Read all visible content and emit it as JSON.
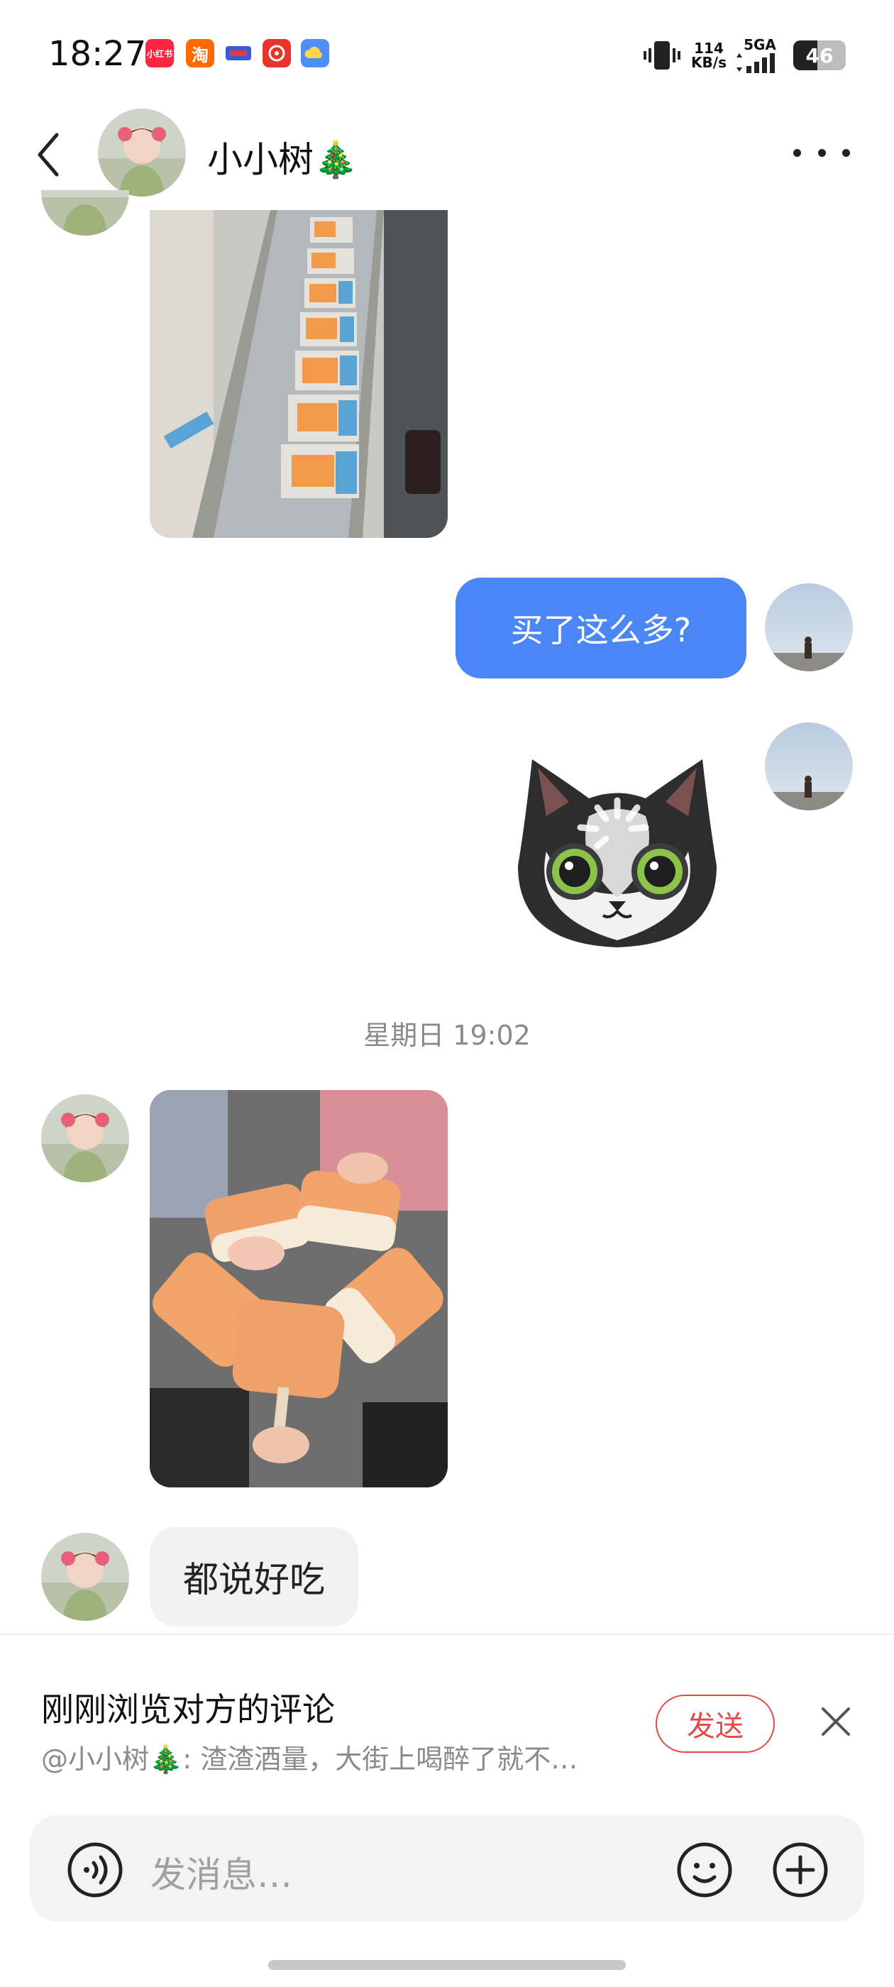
{
  "status_bar": {
    "time": "18:27",
    "apps": [
      "小红书",
      "淘",
      "",
      "",
      ""
    ],
    "speed_value": "114",
    "speed_unit": "KB/s",
    "network": "5GA",
    "battery": "46"
  },
  "header": {
    "contact_name": "小小树🎄",
    "icons": {
      "back": "chevron-left-icon",
      "more": "more-dots-icon"
    }
  },
  "messages": {
    "me_text_1": "买了这么多?",
    "time_separator": "星期日 19:02",
    "them_text_1": "都说好吃"
  },
  "suggestion": {
    "title": "刚刚浏览对方的评论",
    "comment": "@小小树🎄: 渣渣酒量，大街上喝醉了就不…",
    "send_label": "发送"
  },
  "input": {
    "placeholder": "发消息…"
  },
  "colors": {
    "accent_blue": "#4a86f5",
    "send_red": "#e54a4a",
    "bubble_gray": "#f2f2f2"
  }
}
